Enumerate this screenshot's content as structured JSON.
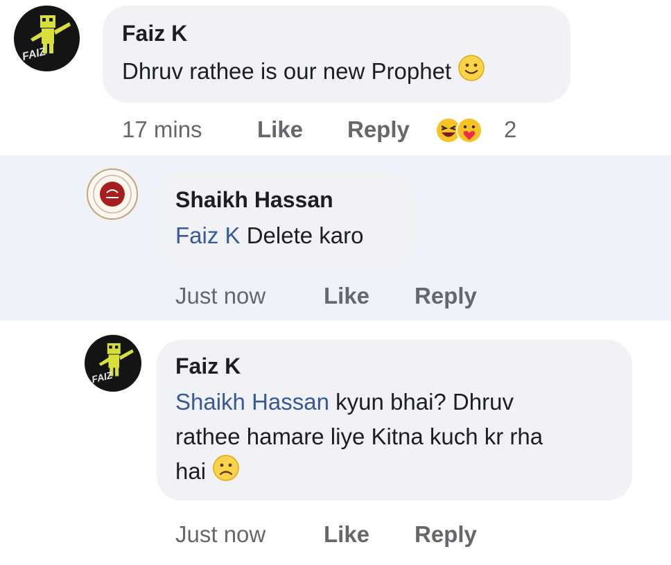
{
  "comments": [
    {
      "author": "Faiz K",
      "avatar_text": "FAIZ",
      "text": "Dhruv rathee is our new Prophet",
      "emoji": "slight-smile-emoji",
      "time": "17 mins",
      "like_label": "Like",
      "reply_label": "Reply",
      "reactions": [
        "laughing-reaction-icon",
        "care-reaction-icon"
      ],
      "reaction_count": "2"
    },
    {
      "author": "Shaikh Hassan",
      "mention": "Faiz K",
      "text": "Delete karo",
      "time": "Just now",
      "like_label": "Like",
      "reply_label": "Reply"
    },
    {
      "author": "Faiz K",
      "avatar_text": "FAIZ",
      "mention": "Shaikh Hassan",
      "text_line1": "kyun bhai?  Dhruv",
      "text_line2": "rathee hamare liye Kitna kuch kr rha",
      "text_line3": "hai",
      "emoji": "frown-emoji",
      "time": "Just now",
      "like_label": "Like",
      "reply_label": "Reply"
    }
  ],
  "colors": {
    "bubble": "#f0f2f5",
    "highlight": "#eef3fb",
    "mention": "#385898",
    "meta": "#65676b"
  }
}
